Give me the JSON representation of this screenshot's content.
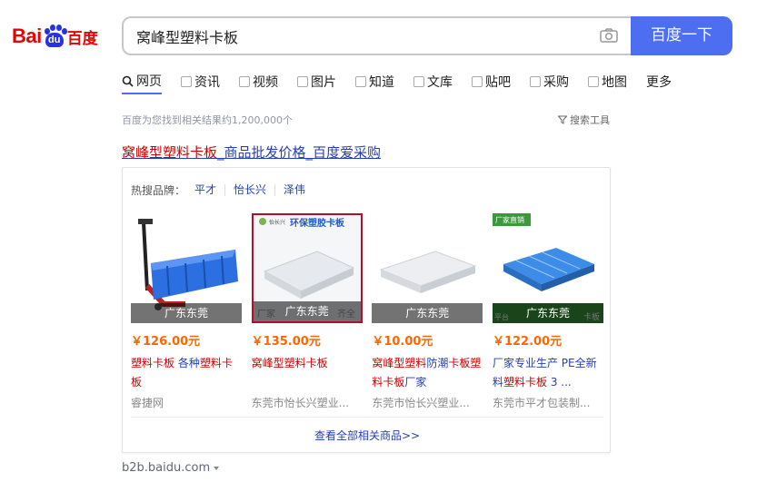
{
  "logo": {
    "bai": "Bai",
    "du": "du",
    "cn": "百度"
  },
  "search": {
    "query": "窝峰型塑料卡板",
    "button": "百度一下"
  },
  "tabs": [
    {
      "label": "网页",
      "icon": "search-icon"
    },
    {
      "label": "资讯",
      "icon": "news-icon"
    },
    {
      "label": "视频",
      "icon": "video-icon"
    },
    {
      "label": "图片",
      "icon": "image-icon"
    },
    {
      "label": "知道",
      "icon": "question-icon"
    },
    {
      "label": "文库",
      "icon": "document-icon"
    },
    {
      "label": "贴吧",
      "icon": "forum-icon"
    },
    {
      "label": "采购",
      "icon": "shopping-icon"
    },
    {
      "label": "地图",
      "icon": "map-icon"
    },
    {
      "label": "更多",
      "icon": ""
    }
  ],
  "stats": "百度为您找到相关结果约1,200,000个",
  "tools": "搜索工具",
  "result": {
    "title_em": "窝峰型塑料卡板",
    "title_rest": "_商品批发价格_百度爱采购",
    "brands_label": "热搜品牌：",
    "brands": [
      "平才",
      "怡长兴",
      "泽伟"
    ],
    "products": [
      {
        "loc": "广东东莞",
        "price": "￥126.00元",
        "name_em": "塑料卡板",
        "name_rest": " 各种",
        "name_em2": "塑料卡板",
        "name_tail": "",
        "shop": "睿捷网"
      },
      {
        "loc": "广东东莞",
        "price": "￥135.00元",
        "name_em": "窝峰型塑料卡板",
        "name_rest": "",
        "name_em2": "",
        "name_tail": "",
        "shop": "东莞市怡长兴塑业..."
      },
      {
        "loc": "广东东莞",
        "price": "￥10.00元",
        "name_em": "窝峰型塑料",
        "name_rest": "防潮",
        "name_em2": "卡板塑料卡板",
        "name_tail": "厂家",
        "shop": "东莞市怡长兴塑业..."
      },
      {
        "loc": "广东东莞",
        "price": "￥122.00元",
        "name_em": "",
        "name_rest": "厂家专业生产 PE全新料",
        "name_em2": "塑料卡板",
        "name_tail": " 3 ...",
        "shop": "东莞市平才包装制..."
      }
    ],
    "thumb_texts": {
      "p2_banner": "环保塑胶卡板",
      "p2_brand": "怡长兴",
      "p2_bottom": "厂家",
      "p2_bottom_right": "齐全",
      "p4_badge": "厂家直销",
      "p4_bottom_left": "平台",
      "p4_bottom_right": "卡板"
    },
    "more": "查看全部相关商品>>",
    "url": "b2b.baidu.com"
  },
  "colors": {
    "accent": "#4e6ef2",
    "link": "#2440b3",
    "highlight": "#c00",
    "price": "#f60"
  }
}
